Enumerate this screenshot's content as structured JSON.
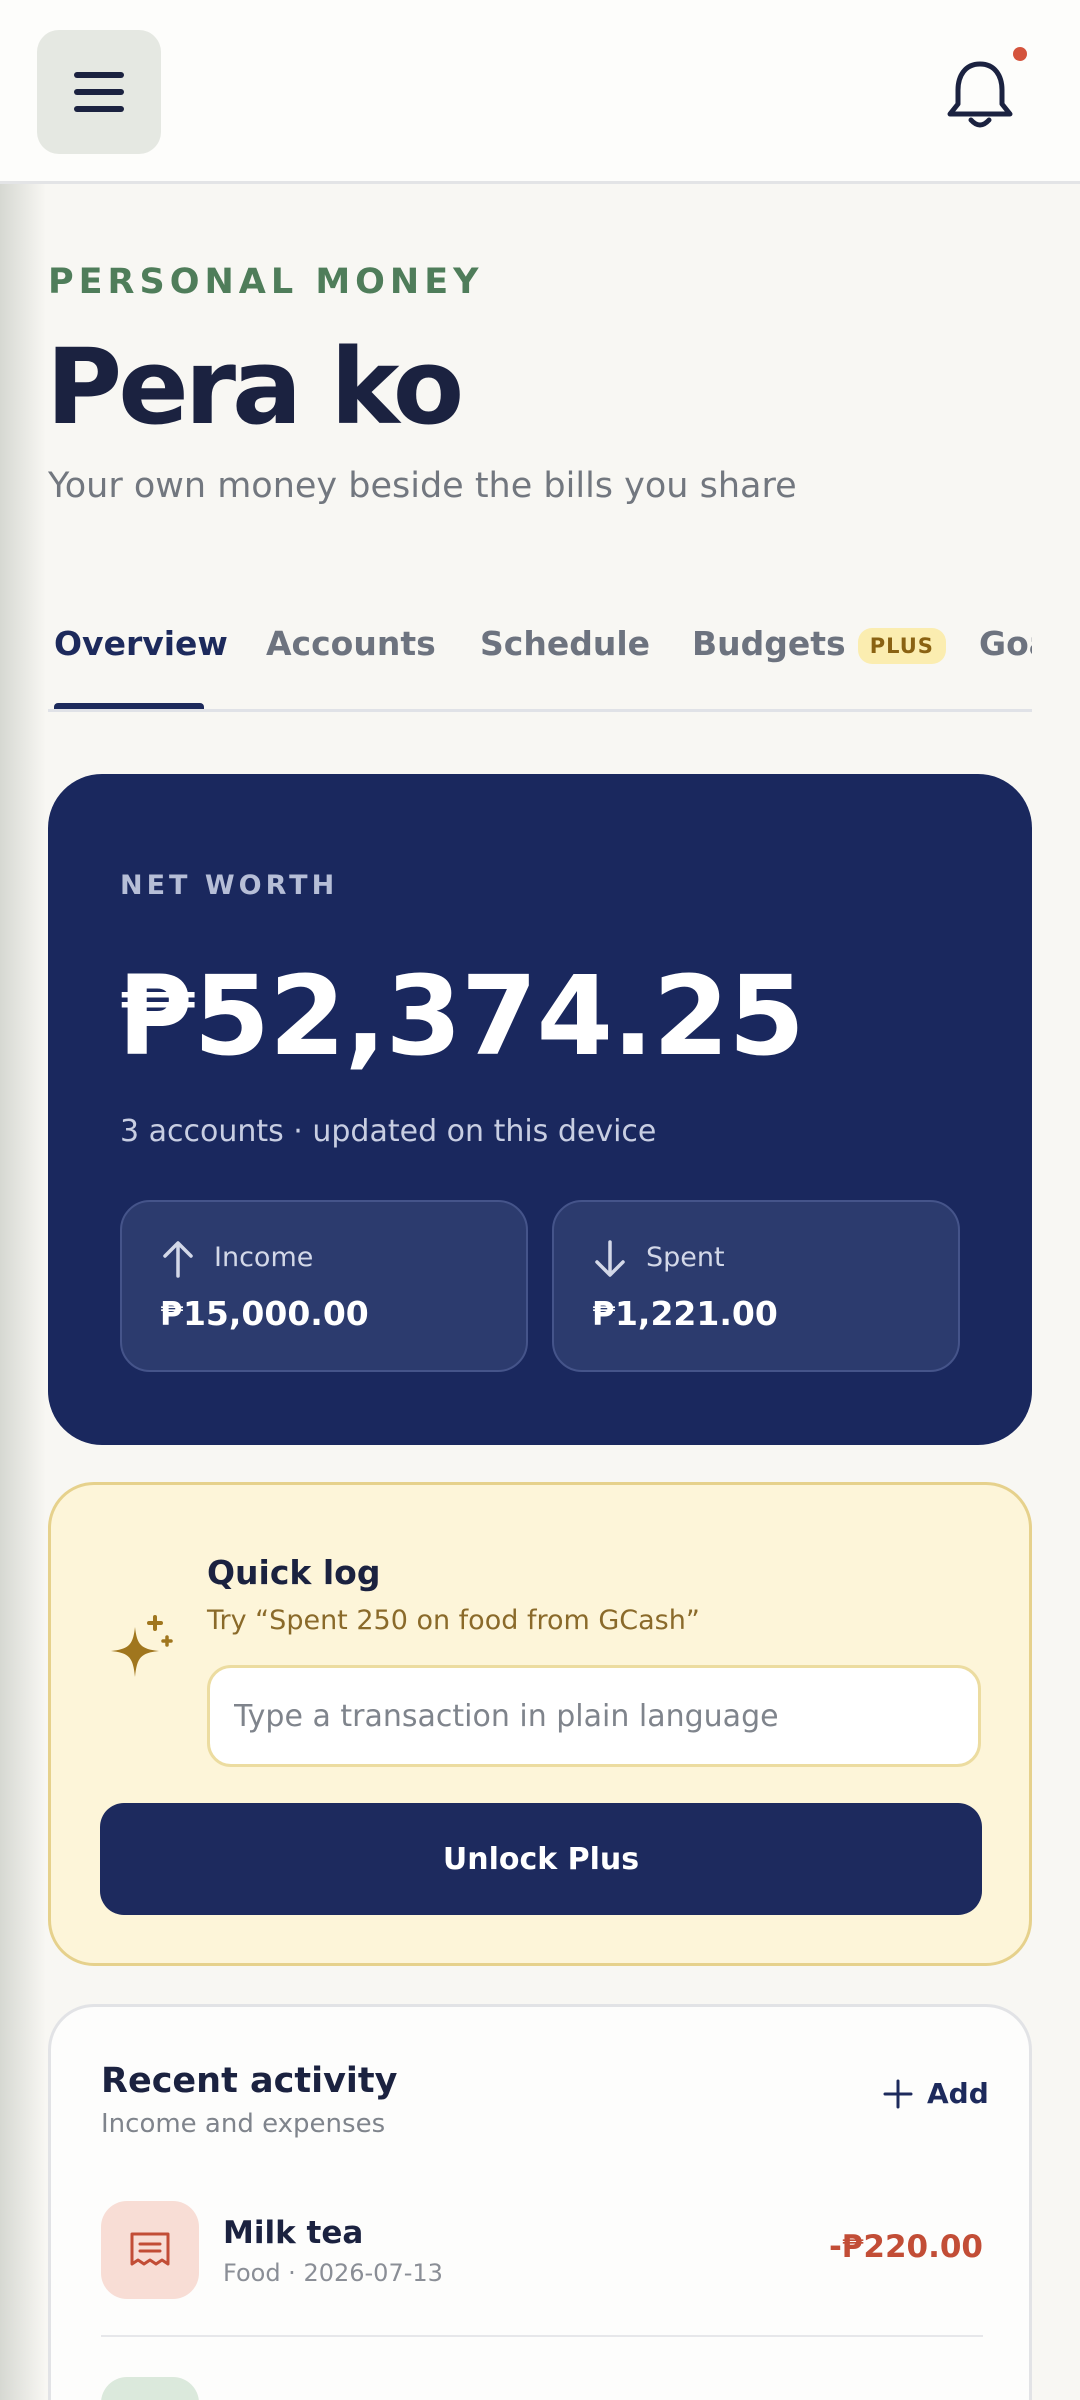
{
  "colors": {
    "accent_navy": "#1a285e",
    "accent_green": "#4f7d5a",
    "expense_red": "#c24d36",
    "notification_dot": "#d4533c",
    "plus_badge_bg": "#fbedb0"
  },
  "header": {
    "menu_icon": "hamburger-menu-icon",
    "notification_icon": "bell-icon"
  },
  "hero": {
    "eyebrow": "PERSONAL MONEY",
    "title": "Pera ko",
    "subtitle": "Your own money beside the bills you share"
  },
  "tabs": [
    {
      "label": "Overview",
      "active": true
    },
    {
      "label": "Accounts",
      "active": false
    },
    {
      "label": "Schedule",
      "active": false
    },
    {
      "label": "Budgets",
      "active": false,
      "badge": "PLUS"
    },
    {
      "label": "Goals",
      "active": false
    }
  ],
  "net_worth": {
    "label": "NET WORTH",
    "value": "₱52,374.25",
    "subtitle": "3 accounts · updated on this device",
    "income": {
      "label": "Income",
      "value": "₱15,000.00",
      "icon": "arrow-up-icon"
    },
    "spent": {
      "label": "Spent",
      "value": "₱1,221.00",
      "icon": "arrow-down-icon"
    }
  },
  "quick_log": {
    "icon": "sparkle-icon",
    "title": "Quick log",
    "hint": "Try “Spent 250 on food from GCash”",
    "input_placeholder": "Type a transaction in plain language",
    "button_label": "Unlock Plus"
  },
  "recent_activity": {
    "title": "Recent activity",
    "subtitle": "Income and expenses",
    "add_label": "Add",
    "transactions": [
      {
        "name": "Milk tea",
        "meta": "Food · 2026-07-13",
        "amount": "-₱220.00",
        "icon": "receipt-icon"
      }
    ]
  }
}
